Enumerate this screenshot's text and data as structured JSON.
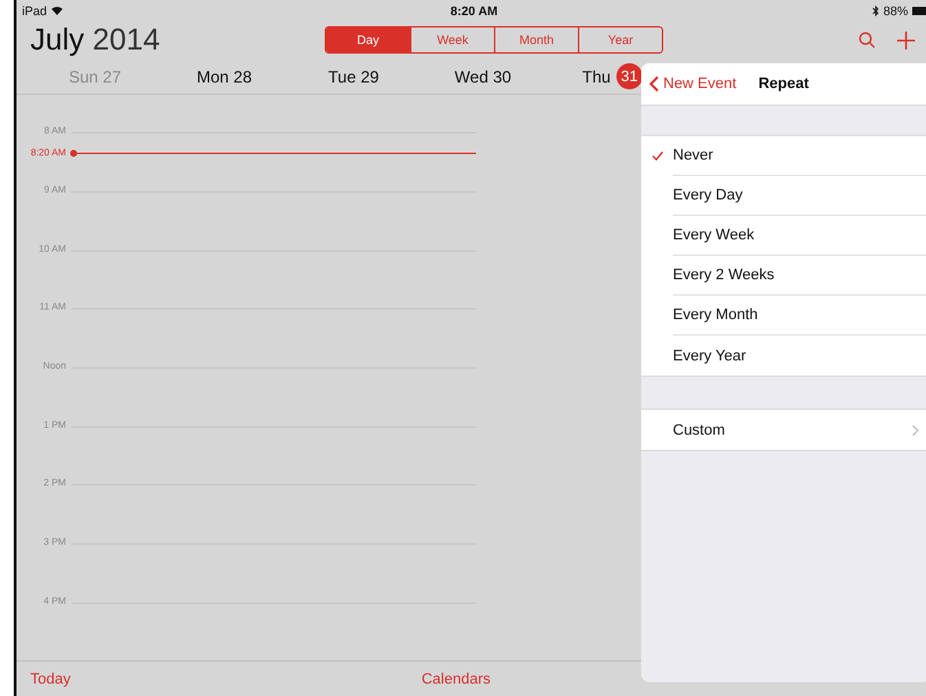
{
  "status_bar": {
    "carrier": "iPad",
    "time": "8:20 AM",
    "battery": "88%"
  },
  "header": {
    "month": "July",
    "year": "2014"
  },
  "views": [
    {
      "label": "Day",
      "selected": true
    },
    {
      "label": "Week",
      "selected": false
    },
    {
      "label": "Month",
      "selected": false
    },
    {
      "label": "Year",
      "selected": false
    }
  ],
  "days": [
    {
      "label": "Sun 27",
      "weekend": true
    },
    {
      "label": "Mon 28",
      "weekend": false
    },
    {
      "label": "Tue 29",
      "weekend": false
    },
    {
      "label": "Wed 30",
      "weekend": false
    },
    {
      "label": "Thu",
      "date": "31",
      "weekend": false,
      "today": true
    }
  ],
  "hours": [
    "8 AM",
    "9 AM",
    "10 AM",
    "11 AM",
    "Noon",
    "1 PM",
    "2 PM",
    "3 PM",
    "4 PM"
  ],
  "now_label": "8:20 AM",
  "popover": {
    "back": "New Event",
    "title": "Repeat",
    "options": [
      {
        "label": "Never",
        "selected": true
      },
      {
        "label": "Every Day",
        "selected": false
      },
      {
        "label": "Every Week",
        "selected": false
      },
      {
        "label": "Every 2 Weeks",
        "selected": false
      },
      {
        "label": "Every Month",
        "selected": false
      },
      {
        "label": "Every Year",
        "selected": false
      }
    ],
    "custom": "Custom"
  },
  "toolbar": {
    "left": "Today",
    "center": "Calendars"
  }
}
